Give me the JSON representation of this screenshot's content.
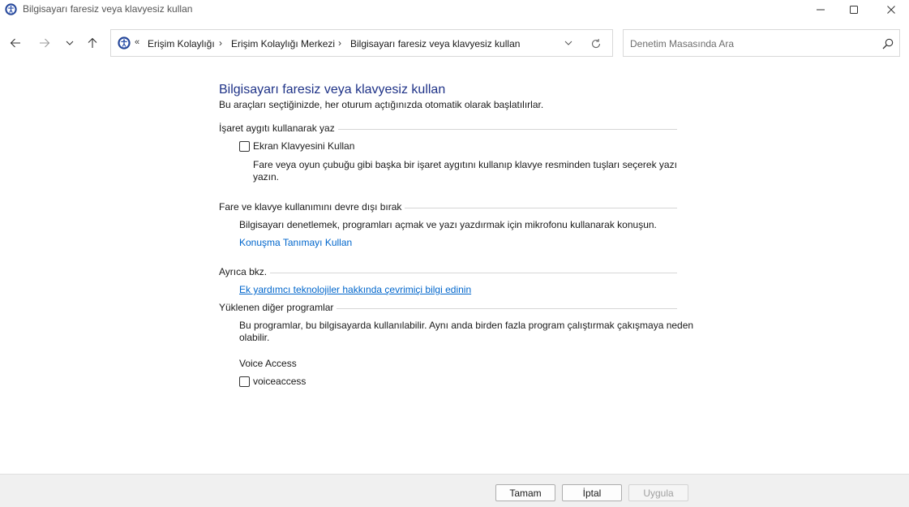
{
  "window": {
    "title": "Bilgisayarı faresiz veya klavyesiz kullan"
  },
  "address": {
    "overflow": "«",
    "crumbs": [
      "Erişim Kolaylığı",
      "Erişim Kolaylığı Merkezi",
      "Bilgisayarı faresiz veya klavyesiz kullan"
    ],
    "separator": "›"
  },
  "search": {
    "placeholder": "Denetim Masasında Ara",
    "value": ""
  },
  "page": {
    "title": "Bilgisayarı faresiz veya klavyesiz kullan",
    "subtitle": "Bu araçları seçtiğinizde, her oturum açtığınızda otomatik olarak başlatılırlar."
  },
  "sections": {
    "pointing": {
      "heading": "İşaret aygıtı kullanarak yaz",
      "checkbox_label": "Ekran Klavyesini Kullan",
      "checked": false,
      "description": "Fare veya oyun çubuğu gibi başka bir işaret aygıtını kullanıp klavye resminden tuşları seçerek yazı yazın."
    },
    "disable": {
      "heading": "Fare ve klavye kullanımını devre dışı bırak",
      "description": "Bilgisayarı denetlemek, programları açmak ve yazı yazdırmak için mikrofonu kullanarak konuşun.",
      "link": "Konuşma Tanımayı Kullan"
    },
    "see_also": {
      "heading": "Ayrıca bkz.",
      "link": "Ek yardımcı teknolojiler hakkında çevrimiçi bilgi edinin"
    },
    "other_programs": {
      "heading": "Yüklenen diğer programlar",
      "description": "Bu programlar, bu bilgisayarda kullanılabilir. Aynı anda birden fazla program çalıştırmak çakışmaya neden olabilir.",
      "program_group": "Voice Access",
      "checkbox_label": "voiceaccess",
      "checked": false
    }
  },
  "footer": {
    "ok": "Tamam",
    "cancel": "İptal",
    "apply": "Uygula",
    "apply_enabled": false
  }
}
